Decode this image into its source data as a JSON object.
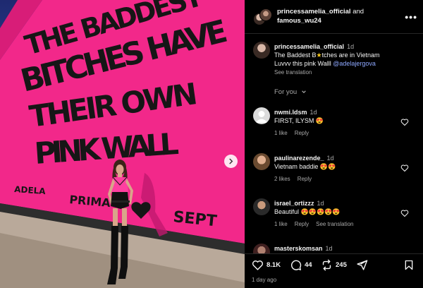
{
  "photo": {
    "wall_text": [
      "THE BADDEST",
      "BITCHES HAVE",
      "THEIR OWN",
      "PINK WALL"
    ],
    "brand_small": "ADELA",
    "brand_bottom": "PRIMA",
    "date_bottom": "SEPT"
  },
  "header": {
    "user1": "princessamelia_official",
    "and": "and",
    "user2": "famous_wu24"
  },
  "caption": {
    "username": "princessamelia_official",
    "time": "1d",
    "text_before": "The Baddest B",
    "text_after": "tches are in Vietnam",
    "line2": "Luvvv this pink Walll",
    "mention": "@adelajergova",
    "see_translation": "See translation"
  },
  "for_you": "For you",
  "comments": [
    {
      "username": "nwmi.ldsm",
      "time": "1d",
      "text": "FIRST, ILYSM",
      "likes": "1 like",
      "reply": "Reply",
      "extra": ""
    },
    {
      "username": "paulinarezende_",
      "time": "1d",
      "text": "Vietnam baddie",
      "likes": "2 likes",
      "reply": "Reply",
      "extra": ""
    },
    {
      "username": "israel_ortizzz",
      "time": "1d",
      "text": "Beautiful",
      "likes": "1 like",
      "reply": "Reply",
      "extra": "See translation"
    },
    {
      "username": "masterskomsan",
      "time": "1d",
      "text": "",
      "likes": "",
      "reply": "",
      "extra": ""
    }
  ],
  "actions": {
    "likes": "8.1K",
    "comments": "44",
    "reposts": "245"
  },
  "time_ago": "1 day ago",
  "colors": {
    "wall_pink": "#f2288a",
    "accent_link": "#8ea8ff",
    "muted": "#a8a8a8"
  }
}
